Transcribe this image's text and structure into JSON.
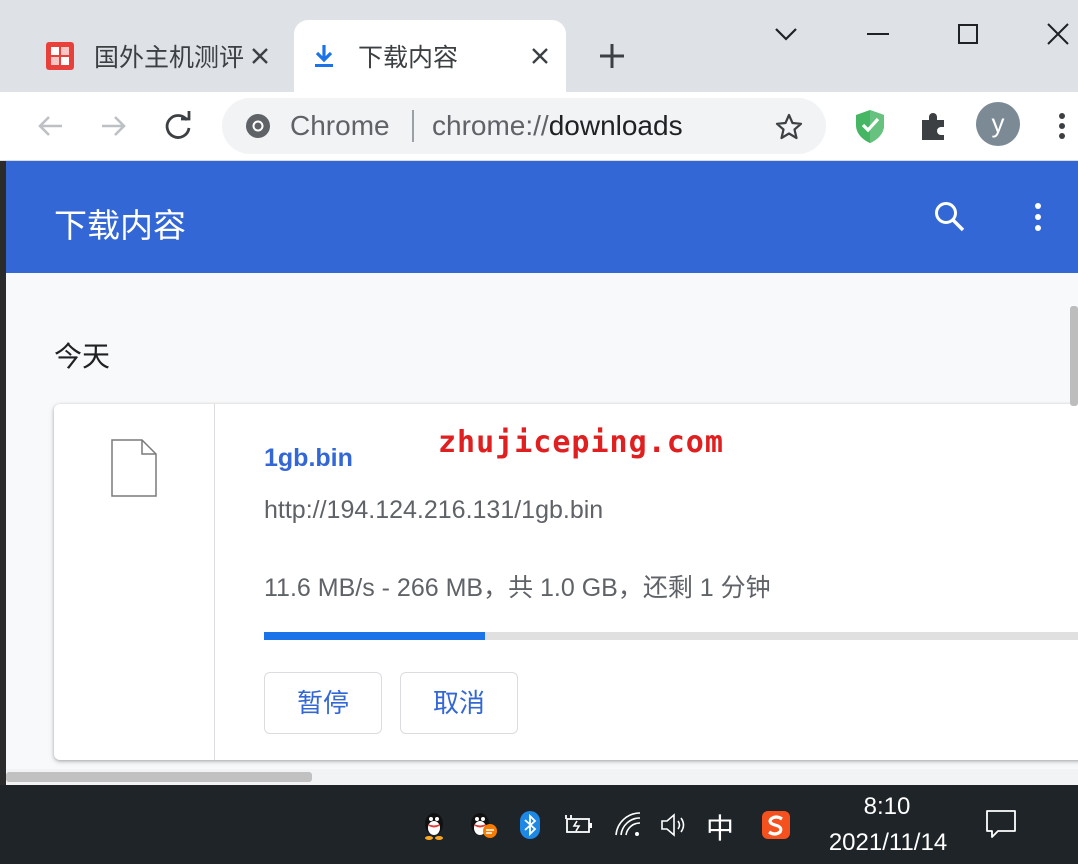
{
  "tabs": [
    {
      "title": "国外主机测评",
      "active": false
    },
    {
      "title": "下载内容",
      "active": true
    }
  ],
  "omnibox": {
    "origin_label": "Chrome",
    "url_scheme": "chrome://",
    "url_host": "downloads"
  },
  "profile": {
    "initial": "y"
  },
  "downloads_page": {
    "title": "下载内容",
    "section_title": "今天",
    "item": {
      "file_name": "1gb.bin",
      "url": "http://194.124.216.131/1gb.bin",
      "progress_text": "11.6 MB/s - 266 MB，共 1.0 GB，还剩 1 分钟",
      "progress_fraction": 0.26,
      "pause_label": "暂停",
      "cancel_label": "取消"
    }
  },
  "watermark": "zhujiceping.com",
  "taskbar": {
    "time": "8:10",
    "date": "2021/11/14",
    "ime_label": "中"
  },
  "colors": {
    "accent": "#3367d6",
    "progress": "#1a73e8",
    "watermark": "#e02020"
  }
}
